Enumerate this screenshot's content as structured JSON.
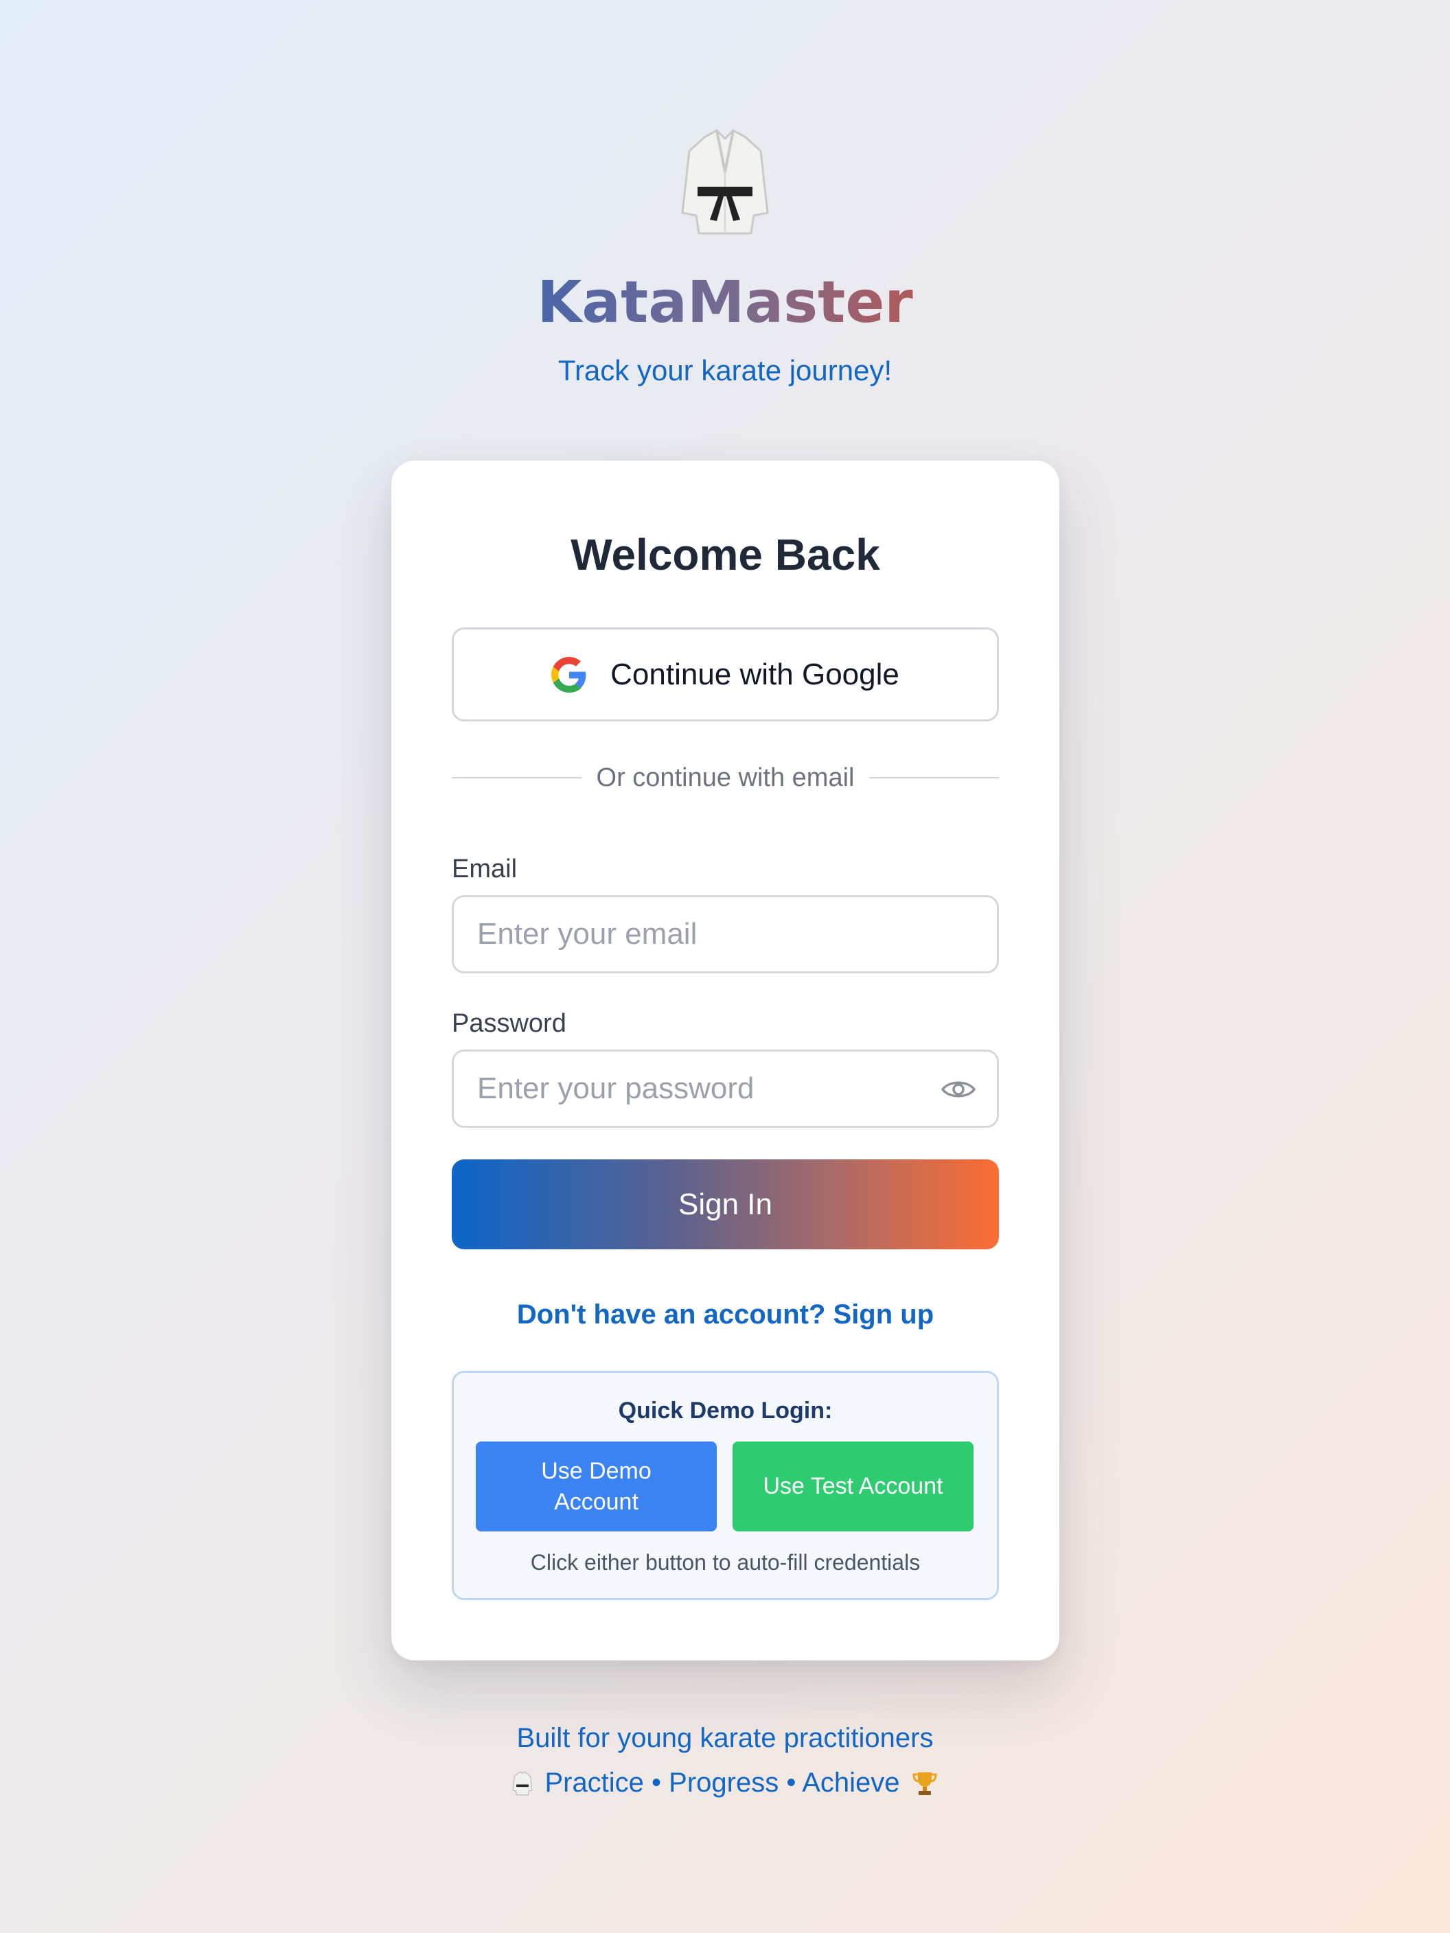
{
  "header": {
    "brand": "KataMaster",
    "tagline": "Track your karate journey!",
    "logo_icon": "karate-gi-icon"
  },
  "card": {
    "title": "Welcome Back",
    "google_button": "Continue with Google",
    "divider_text": "Or continue with email",
    "email_label": "Email",
    "email_placeholder": "Enter your email",
    "email_value": "",
    "password_label": "Password",
    "password_placeholder": "Enter your password",
    "password_value": "",
    "signin_button": "Sign In",
    "signup_link": "Don't have an account? Sign up"
  },
  "demo": {
    "title": "Quick Demo Login:",
    "demo_button": "Use Demo Account",
    "test_button": "Use Test Account",
    "hint": "Click either button to auto-fill credentials"
  },
  "footer": {
    "line1": "Built for young karate practitioners",
    "line2": "Practice • Progress • Achieve"
  },
  "colors": {
    "primary_blue": "#1266c4",
    "gradient_start": "#0b65c8",
    "gradient_end": "#fb6d34",
    "demo_blue": "#3b82f2",
    "demo_green": "#2ecb70"
  }
}
